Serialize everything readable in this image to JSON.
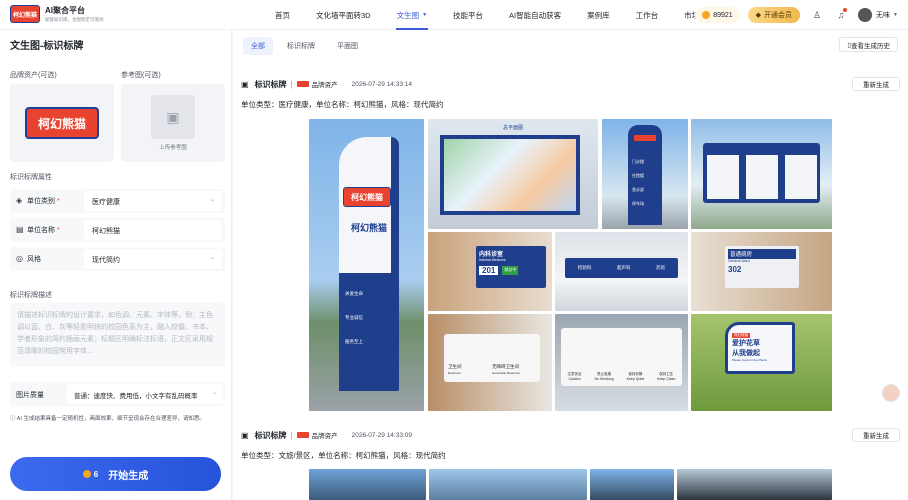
{
  "app": {
    "logo_text": "柯幻熊猫",
    "title": "AI聚合平台",
    "subtitle": "赋能知识库，也图稳定可落地"
  },
  "nav": [
    {
      "label": "首页",
      "active": false
    },
    {
      "label": "文化墙平面转3D",
      "active": false
    },
    {
      "label": "文生图",
      "active": true
    },
    {
      "label": "技能平台",
      "active": false
    },
    {
      "label": "AI智能自动获客",
      "active": false
    },
    {
      "label": "案例库",
      "active": false
    },
    {
      "label": "工作台",
      "active": false
    },
    {
      "label": "市场合作",
      "active": false
    }
  ],
  "user": {
    "points": "89921",
    "vip_label": "开通会员",
    "name": "无味"
  },
  "left": {
    "page_title": "文生图-标识标牌",
    "brand_asset_label": "品牌资产(可选)",
    "ref_label": "参考图(可选)",
    "brand_logo_text": "柯幻熊猫",
    "upload_label": "上传参考图",
    "attr_section": "标识标牌属性",
    "fields": [
      {
        "icon": "layers-icon",
        "name": "单位类别",
        "required": true,
        "value": "医疗健康",
        "select": true
      },
      {
        "icon": "card-icon",
        "name": "单位名称",
        "required": true,
        "value": "柯幻熊猫",
        "select": false
      },
      {
        "icon": "palette-icon",
        "name": "风格",
        "required": false,
        "value": "现代简约",
        "select": true
      }
    ],
    "desc_label": "标识标牌描述",
    "desc_placeholder": "请描述标识标牌的设计要求，如色调、元素、字体等。例：主色调以蓝、白、灰等轻盈明快的校园色系为主，融入校徽、书本、学者形象的简约插画元素；标题区明确标注标语，正文区采用规范清晰的校园常用字体…",
    "quality_label": "图片质量",
    "quality_value": "普通：速度快、费用低，小文字有乱码概率",
    "notice": "AI 生成结果具备一定随机性，画面效果、细节呈现会存在合理差异，请知悉。",
    "generate_cost": "6",
    "generate_label": "开始生成"
  },
  "main": {
    "tabs": [
      {
        "label": "全部",
        "active": true
      },
      {
        "label": "标识标牌",
        "active": false
      },
      {
        "label": "平面图",
        "active": false
      }
    ],
    "history_label": "查看生成历史",
    "tasks": [
      {
        "type": "标识标牌",
        "brand": "品牌资产",
        "time": "2026-07-29 14:33:14",
        "regen": "重新生成",
        "desc": "单位类型：医疗健康，单位名称：柯幻熊猫，风格：现代简约"
      },
      {
        "type": "标识标牌",
        "brand": "品牌资产",
        "time": "2026-07-29 14:33:09",
        "regen": "重新生成",
        "desc": "单位类型：文旅/景区，单位名称：柯幻熊猫，风格：现代简约"
      }
    ],
    "images": {
      "pylon_logo": "柯幻熊猫",
      "pylon_name": "柯幻熊猫",
      "pylon_items": [
        "关爱生命",
        "专业诚信",
        "服务至上"
      ],
      "map_title": "总平面图",
      "totem_items": [
        "门诊楼",
        "住院楼",
        "急诊部",
        "停车场"
      ],
      "board_title": "柯幻熊猫",
      "room1_name": "内科诊室",
      "room1_en": "Internal Medicine",
      "room1_no": "201",
      "room1_status": "就诊中",
      "hang_items": [
        "检验科",
        "超声科",
        "药房"
      ],
      "ward_name": "普通病房",
      "ward_en": "General Ward",
      "ward_no": "302",
      "wc1": "卫生间",
      "wc1_en": "Restroom",
      "wc2": "无障碍卫生间",
      "wc2_en": "Accessible Restroom",
      "safety": [
        "注意安全",
        "禁止吸烟",
        "保持安静",
        "保持卫生"
      ],
      "safety_en": [
        "Caution",
        "No Smoking",
        "Keep Quiet",
        "Keep Clean"
      ],
      "lawn_title": "爱护花草",
      "lawn_sub": "从我做起",
      "lawn_en": "Please Care for the Plants",
      "lawn_logo": "柯幻熊猫"
    }
  },
  "colors": {
    "primary": "#3b5bdb",
    "brand_red": "#e8432e",
    "brand_blue": "#1f3f8c"
  }
}
